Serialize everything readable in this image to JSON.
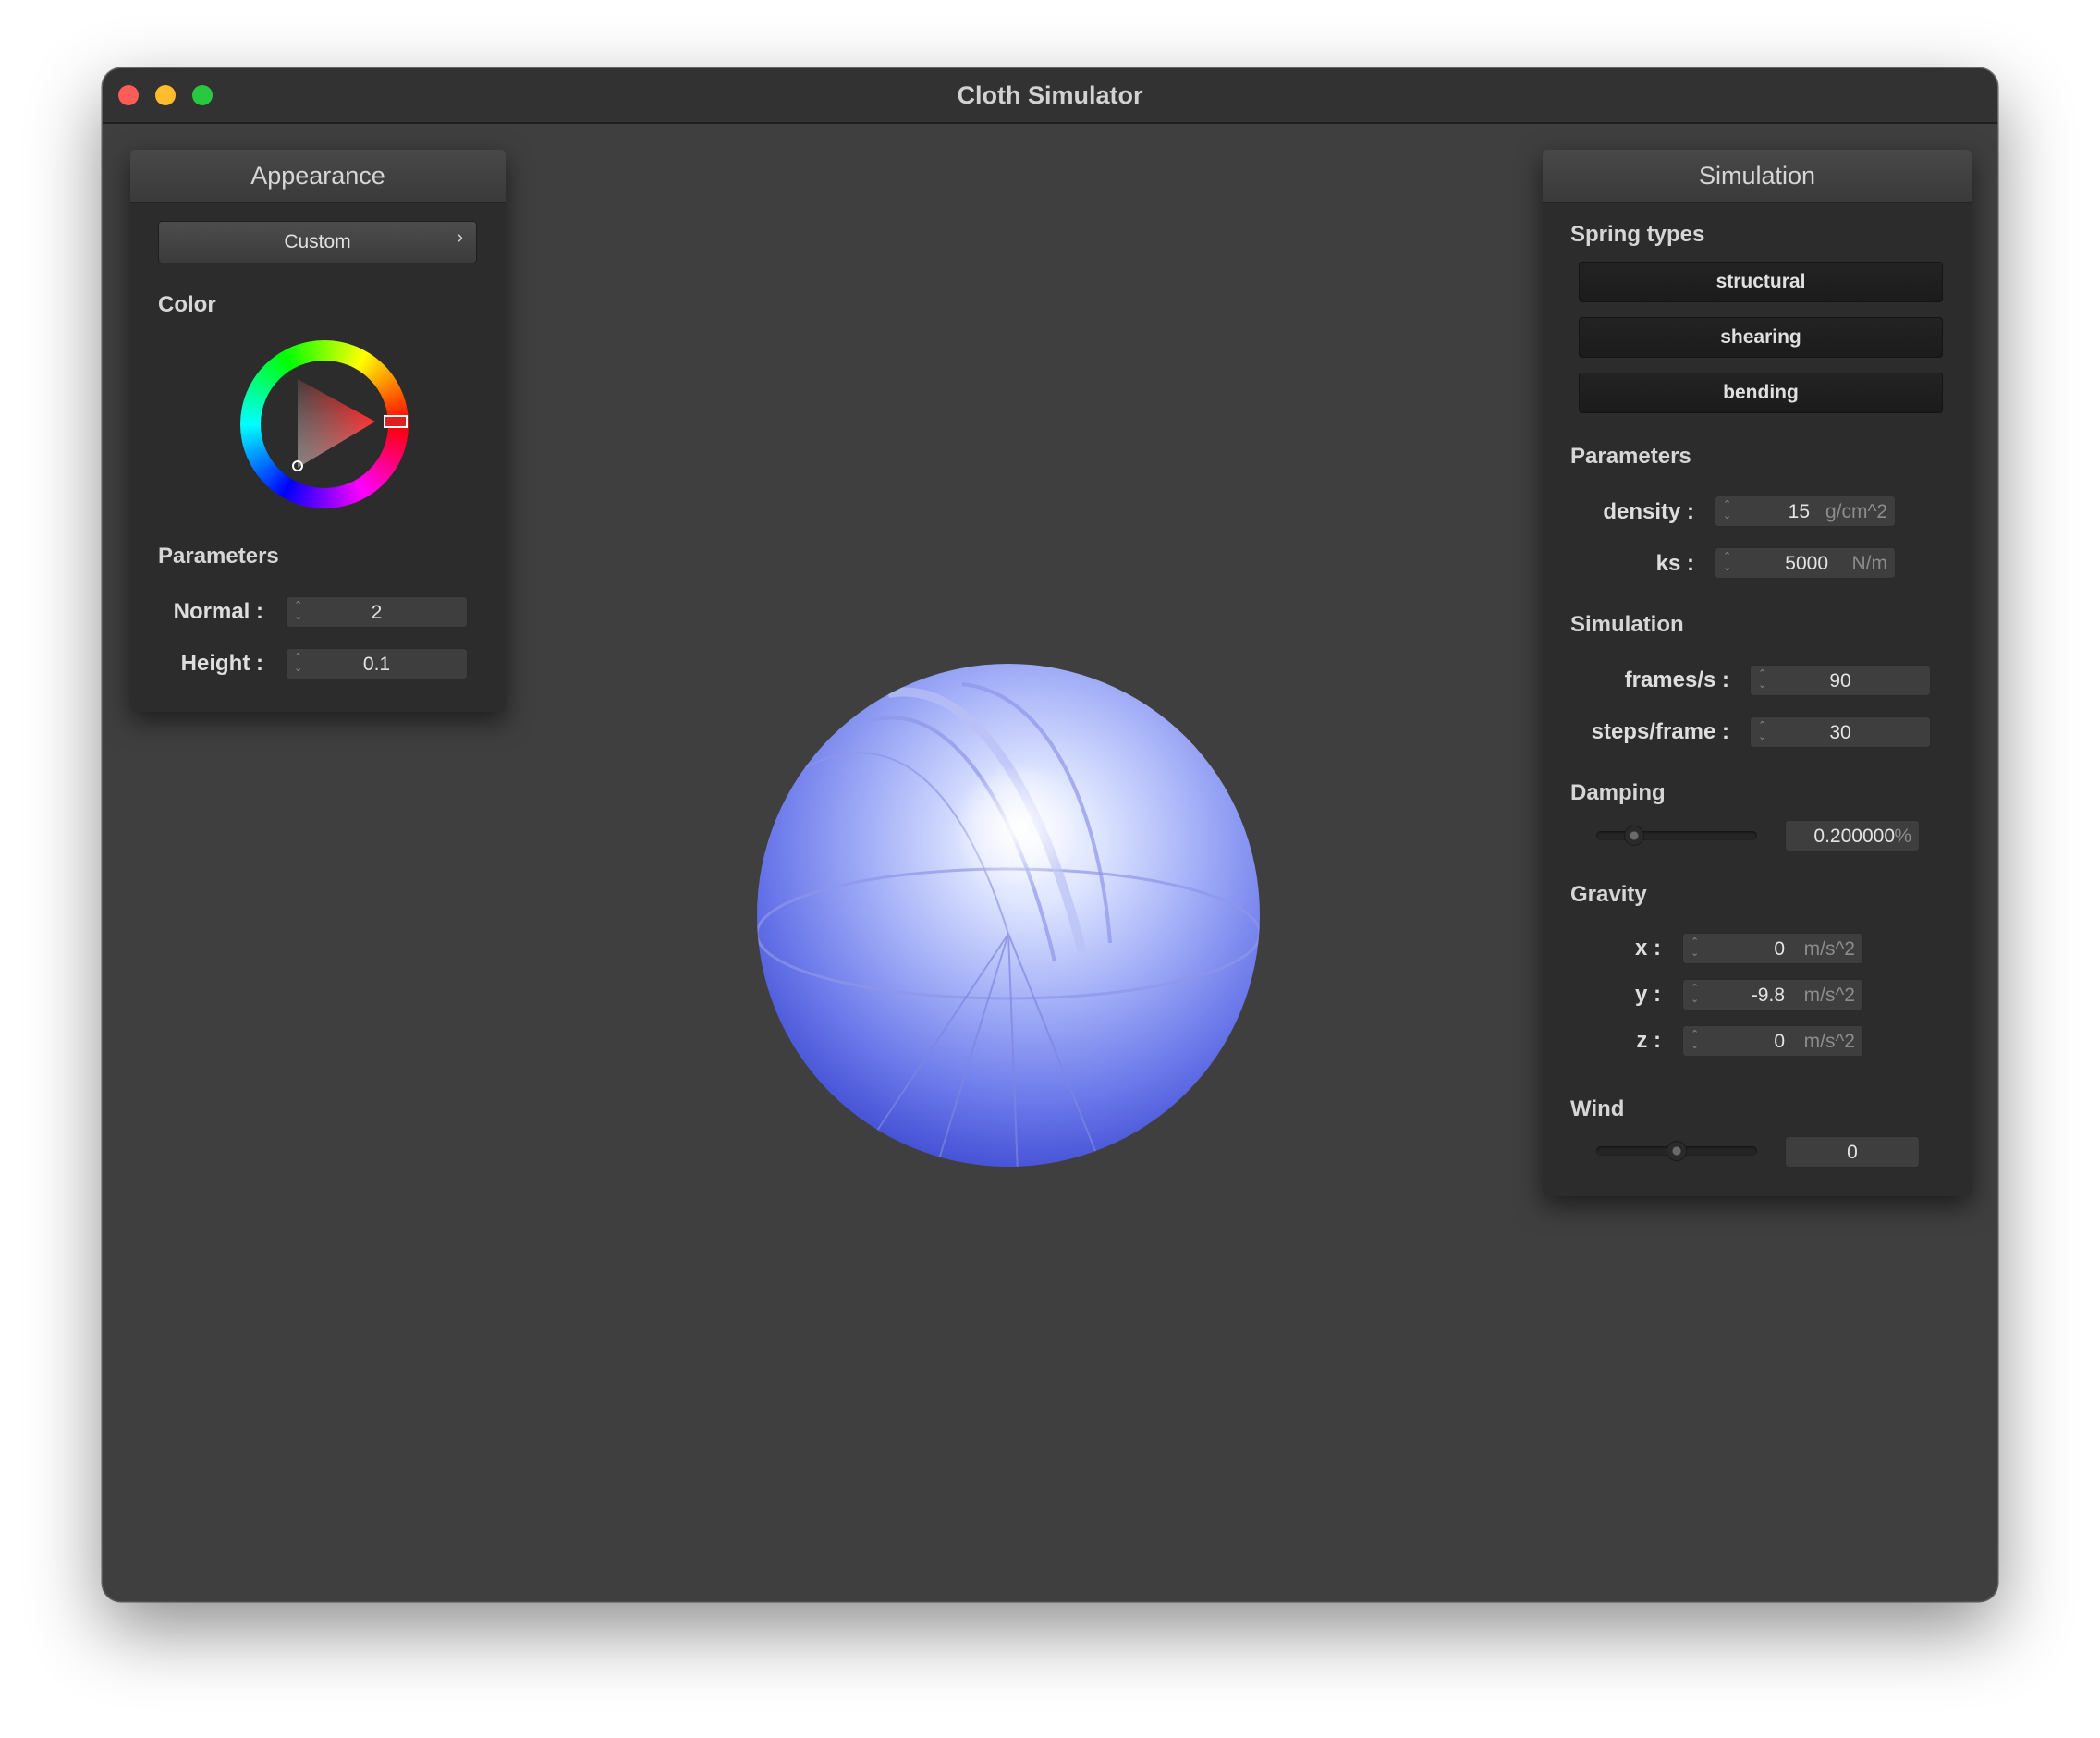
{
  "window": {
    "title": "Cloth Simulator"
  },
  "appearance": {
    "header": "Appearance",
    "preset": "Custom",
    "color_label": "Color",
    "color": "#ff2020",
    "params_label": "Parameters",
    "normal_label": "Normal :",
    "normal_value": "2",
    "height_label": "Height :",
    "height_value": "0.1"
  },
  "simulation": {
    "header": "Simulation",
    "spring_types_label": "Spring types",
    "springs": [
      "structural",
      "shearing",
      "bending"
    ],
    "params_label": "Parameters",
    "density_label": "density :",
    "density_value": "15",
    "density_unit": "g/cm^2",
    "ks_label": "ks :",
    "ks_value": "5000",
    "ks_unit": "N/m",
    "sim_label": "Simulation",
    "fps_label": "frames/s :",
    "fps_value": "90",
    "steps_label": "steps/frame :",
    "steps_value": "30",
    "damping_label": "Damping",
    "damping_value": "0.200000",
    "damping_unit": "%",
    "damping_level": 0.2,
    "gravity_label": "Gravity",
    "gx_label": "x :",
    "gx_value": "0",
    "gy_label": "y :",
    "gy_value": "-9.8",
    "gz_label": "z :",
    "gz_value": "0",
    "gravity_unit": "m/s^2",
    "wind_label": "Wind",
    "wind_value": "0",
    "wind_level": 0.5
  }
}
